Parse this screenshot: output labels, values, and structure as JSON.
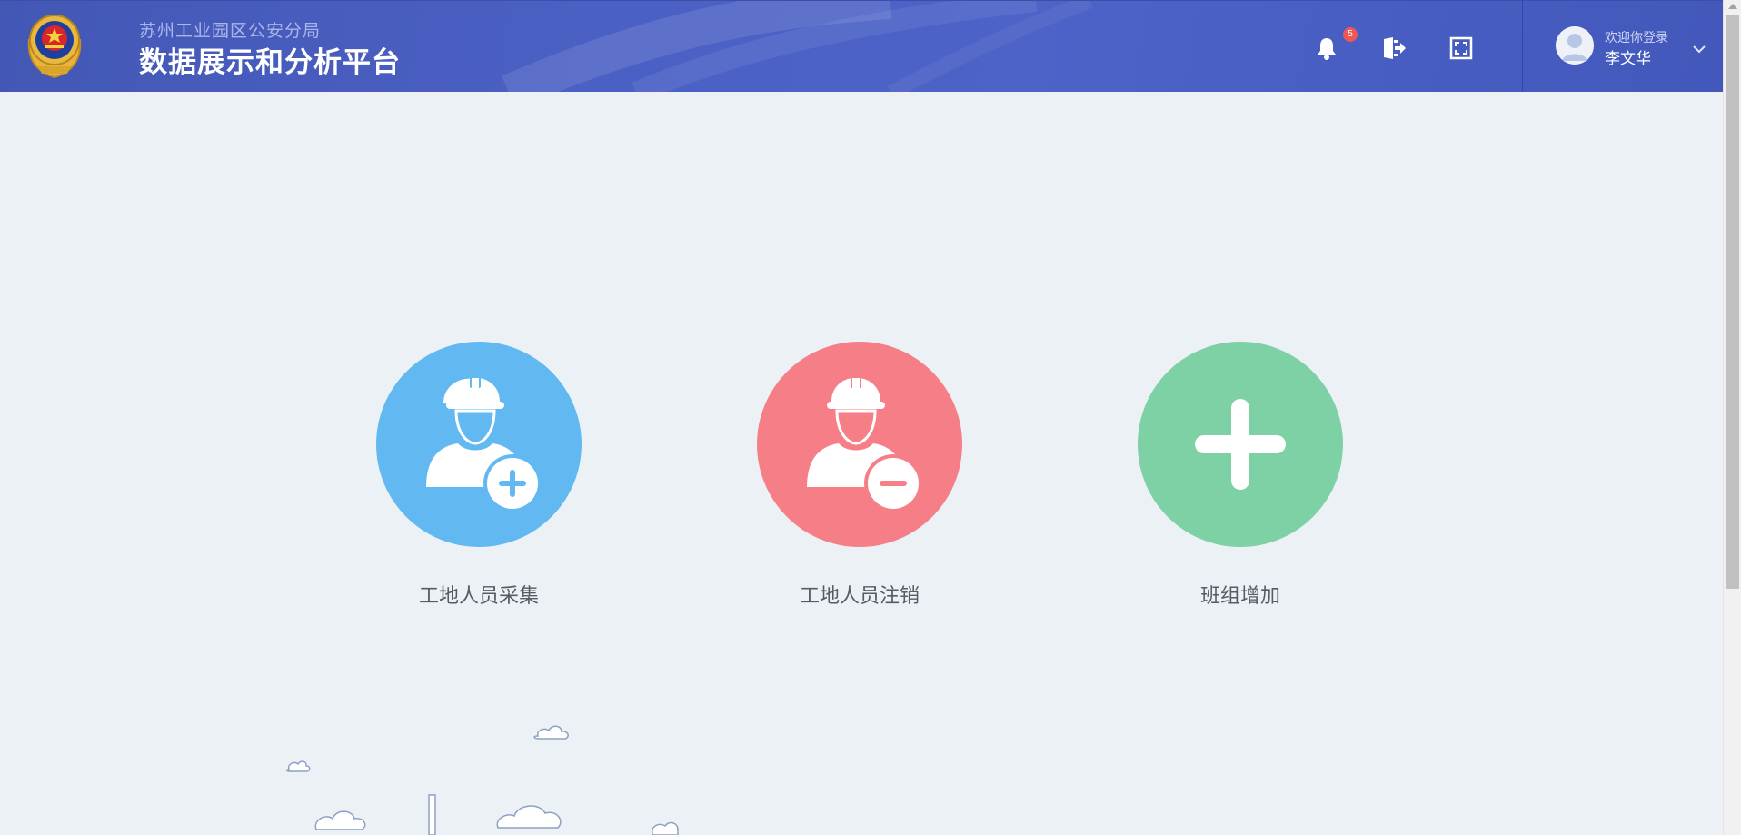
{
  "header": {
    "subtitle": "苏州工业园区公安分局",
    "title": "数据展示和分析平台",
    "notification_count": "5",
    "user": {
      "welcome": "欢迎你登录",
      "name": "李文华"
    },
    "icons": [
      "police-emblem",
      "bell-icon",
      "logout-icon",
      "fullscreen-icon",
      "avatar",
      "chevron-down-icon"
    ]
  },
  "actions": [
    {
      "label": "工地人员采集",
      "color": "#62b9f2",
      "icon": "worker-add-icon"
    },
    {
      "label": "工地人员注销",
      "color": "#f67f87",
      "icon": "worker-remove-icon"
    },
    {
      "label": "班组增加",
      "color": "#7ed1a4",
      "icon": "plus-icon"
    }
  ],
  "colors": {
    "header": "#4b60c4",
    "background": "#ecf1f6",
    "label_text": "#555c66"
  }
}
